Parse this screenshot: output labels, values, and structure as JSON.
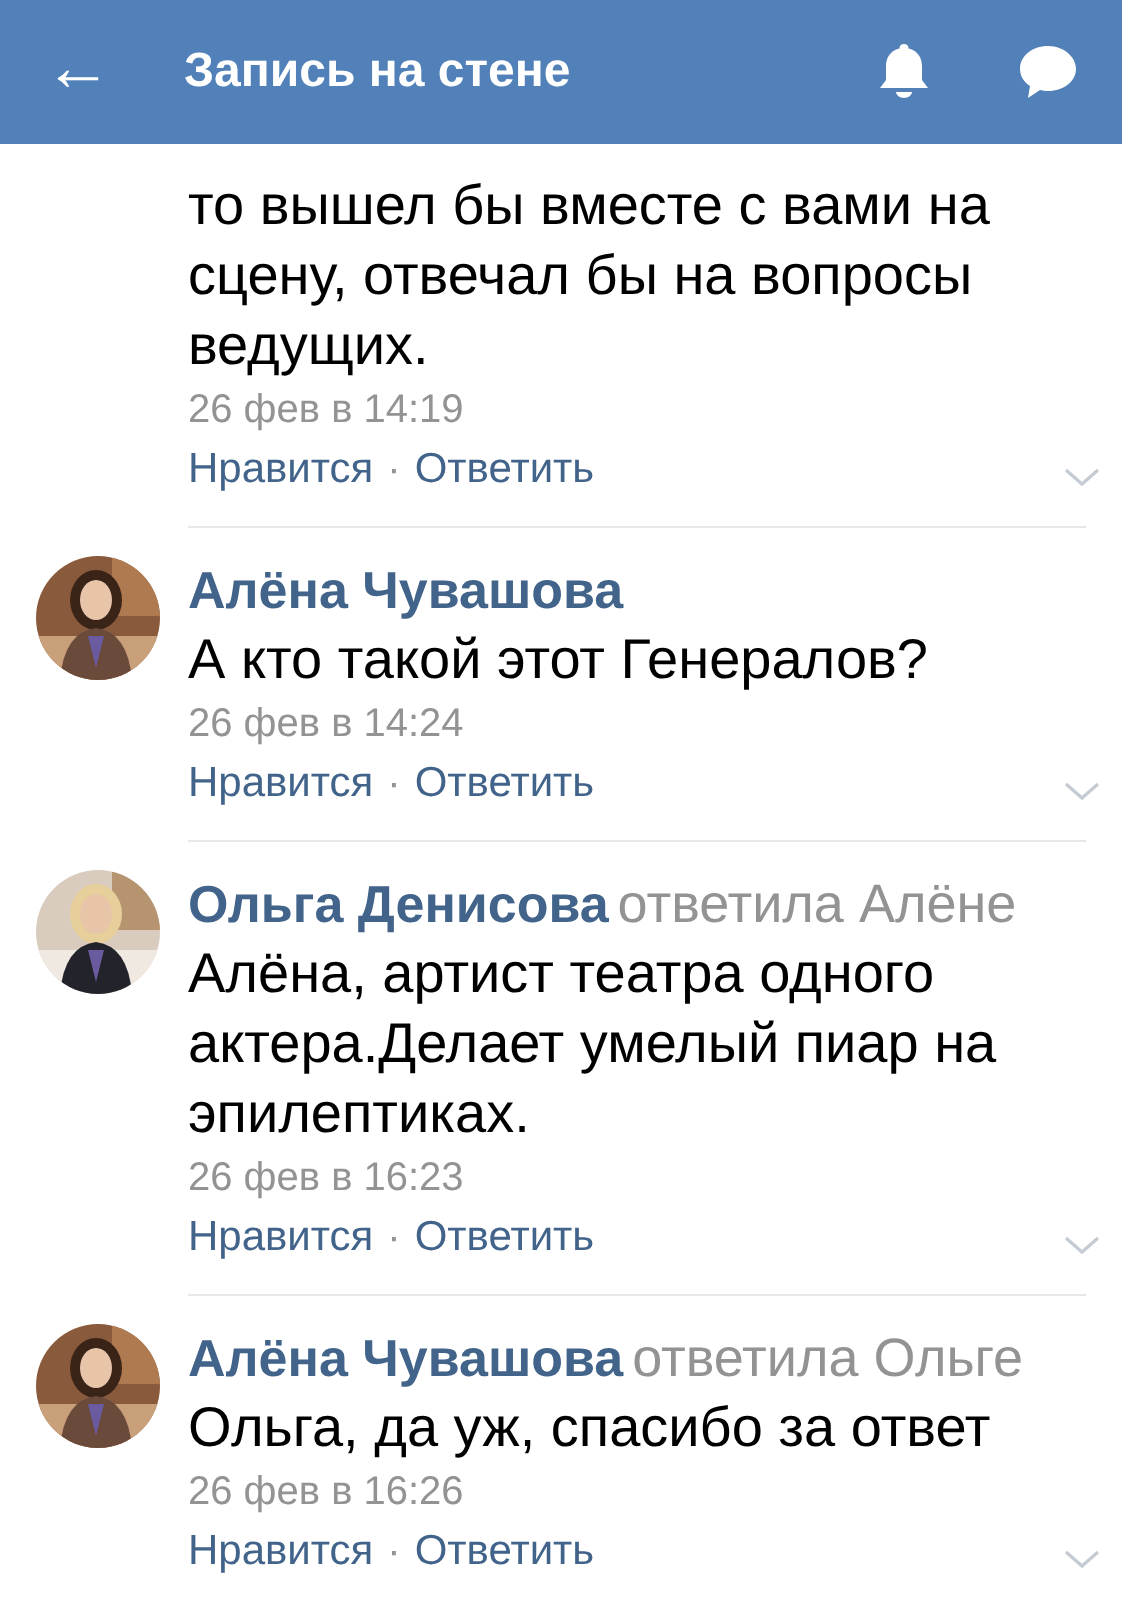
{
  "header": {
    "back": "←",
    "title": "Запись на стене"
  },
  "comments": [
    {
      "text": "то вышел бы вместе с вами на сцену, отвечал бы на вопросы ведущих.",
      "time": "26 фев в 14:19",
      "like": "Нравится",
      "separator": "·",
      "reply": "Ответить"
    },
    {
      "author": "Алёна Чувашова",
      "text": "А кто такой этот Генералов?",
      "time": "26 фев в 14:24",
      "like": "Нравится",
      "separator": "·",
      "reply": "Ответить"
    },
    {
      "author": "Ольга Денисова",
      "reply_to": "ответила Алёне",
      "text": "Алёна, артист театра одного актера.Делает умелый пиар на эпилептиках.",
      "time": "26 фев в 16:23",
      "like": "Нравится",
      "separator": "·",
      "reply": "Ответить"
    },
    {
      "author": "Алёна Чувашова",
      "reply_to": "ответила Ольге",
      "text": "Ольга, да уж, спасибо за ответ",
      "time": "26 фев в 16:26",
      "like": "Нравится",
      "separator": "·",
      "reply": "Ответить"
    }
  ]
}
